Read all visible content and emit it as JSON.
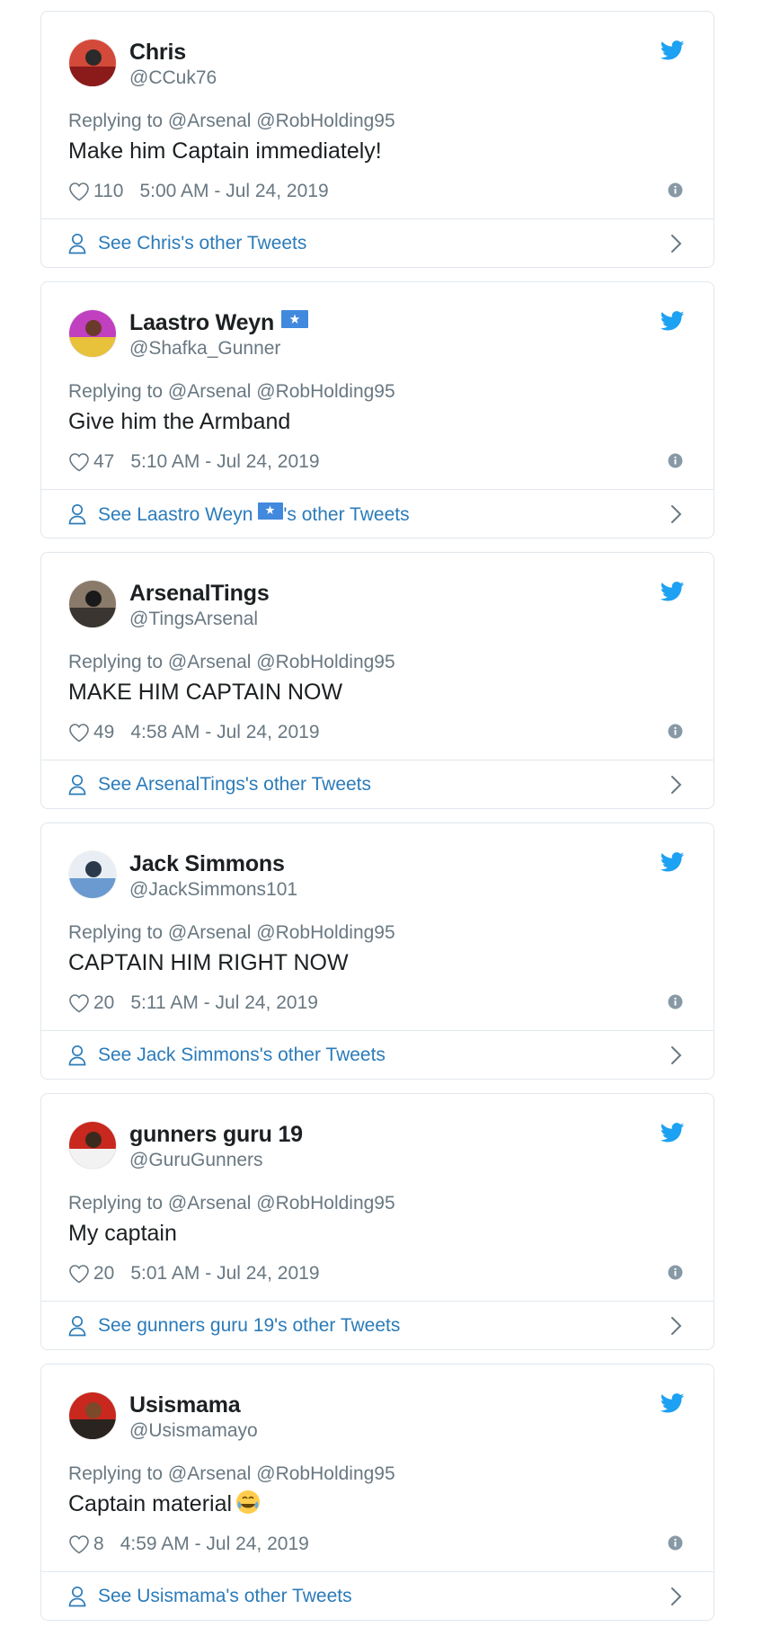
{
  "tweets": [
    {
      "name": "Chris",
      "has_flag": false,
      "handle": "@CCuk76",
      "reply_context": "Replying to @Arsenal @RobHolding95",
      "text": "Make him Captain immediately!",
      "emoji": "",
      "likes": "110",
      "timestamp": "5:00 AM - Jul 24, 2019",
      "see_more_prefix": "See Chris",
      "see_more_suffix": "'s other Tweets",
      "avatar_colors": [
        "#8b1a1a",
        "#d44a3a",
        "#2a2a2a"
      ]
    },
    {
      "name": "Laastro Weyn",
      "has_flag": true,
      "handle": "@Shafka_Gunner",
      "reply_context": "Replying to @Arsenal @RobHolding95",
      "text": "Give him the Armband",
      "emoji": "",
      "likes": "47",
      "timestamp": "5:10 AM - Jul 24, 2019",
      "see_more_prefix": "See Laastro Weyn",
      "see_more_suffix": "'s other Tweets",
      "avatar_colors": [
        "#e8c23a",
        "#c040c0",
        "#6a3a2a"
      ]
    },
    {
      "name": "ArsenalTings",
      "has_flag": false,
      "handle": "@TingsArsenal",
      "reply_context": "Replying to @Arsenal @RobHolding95",
      "text": "MAKE HIM CAPTAIN NOW",
      "emoji": "",
      "likes": "49",
      "timestamp": "4:58 AM - Jul 24, 2019",
      "see_more_prefix": "See ArsenalTings",
      "see_more_suffix": "'s other Tweets",
      "avatar_colors": [
        "#3a3530",
        "#8a7a6a",
        "#1a1a1a"
      ]
    },
    {
      "name": "Jack Simmons",
      "has_flag": false,
      "handle": "@JackSimmons101",
      "reply_context": "Replying to @Arsenal @RobHolding95",
      "text": "CAPTAIN HIM RIGHT NOW",
      "emoji": "",
      "likes": "20",
      "timestamp": "5:11 AM - Jul 24, 2019",
      "see_more_prefix": "See Jack Simmons",
      "see_more_suffix": "'s other Tweets",
      "avatar_colors": [
        "#6a9ad0",
        "#e8eef4",
        "#2a3a4a"
      ]
    },
    {
      "name": "gunners guru 19",
      "has_flag": false,
      "handle": "@GuruGunners",
      "reply_context": "Replying to @Arsenal @RobHolding95",
      "text": "My captain",
      "emoji": "",
      "likes": "20",
      "timestamp": "5:01 AM - Jul 24, 2019",
      "see_more_prefix": "See gunners guru 19",
      "see_more_suffix": "'s other Tweets",
      "avatar_colors": [
        "#f2f2f2",
        "#c8281e",
        "#3a2a1e"
      ]
    },
    {
      "name": "Usismama",
      "has_flag": false,
      "handle": "@Usismamayo",
      "reply_context": "Replying to @Arsenal @RobHolding95",
      "text": "Captain material",
      "emoji": "😂",
      "likes": "8",
      "timestamp": "4:59 AM - Jul 24, 2019",
      "see_more_prefix": "See Usismama",
      "see_more_suffix": "'s other Tweets",
      "avatar_colors": [
        "#2a2420",
        "#c8281e",
        "#7a4a2a"
      ]
    }
  ],
  "colors": {
    "twitter_blue": "#1da1f2",
    "link_blue": "#2b7bb9",
    "secondary_text": "#697882",
    "border": "#e1e8ed",
    "flag_blue": "#4189dd"
  }
}
